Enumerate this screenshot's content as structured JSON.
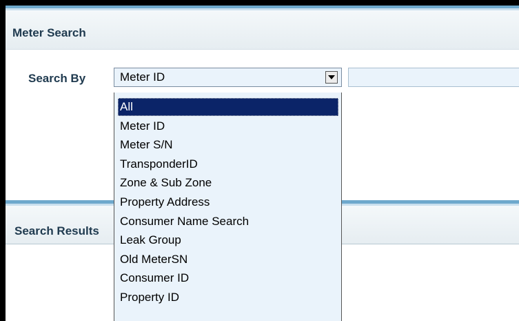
{
  "meter_search": {
    "title": "Meter Search",
    "search_by_label": "Search By",
    "selected_value": "Meter ID",
    "search_input_value": ""
  },
  "search_results": {
    "title": "Search Results"
  },
  "dropdown": {
    "options": [
      {
        "label": "All",
        "highlighted": true
      },
      {
        "label": "Meter ID"
      },
      {
        "label": "Meter S/N"
      },
      {
        "label": "TransponderID"
      },
      {
        "label": "Zone & Sub Zone"
      },
      {
        "label": "Property Address"
      },
      {
        "label": "Consumer Name Search"
      },
      {
        "label": "Leak Group"
      },
      {
        "label": "Old MeterSN"
      },
      {
        "label": "Consumer ID"
      },
      {
        "label": "Property ID"
      }
    ]
  },
  "colors": {
    "panel_accent": "#6ea8cc",
    "highlight": "#0b2468",
    "input_bg": "#eaf3fb"
  }
}
